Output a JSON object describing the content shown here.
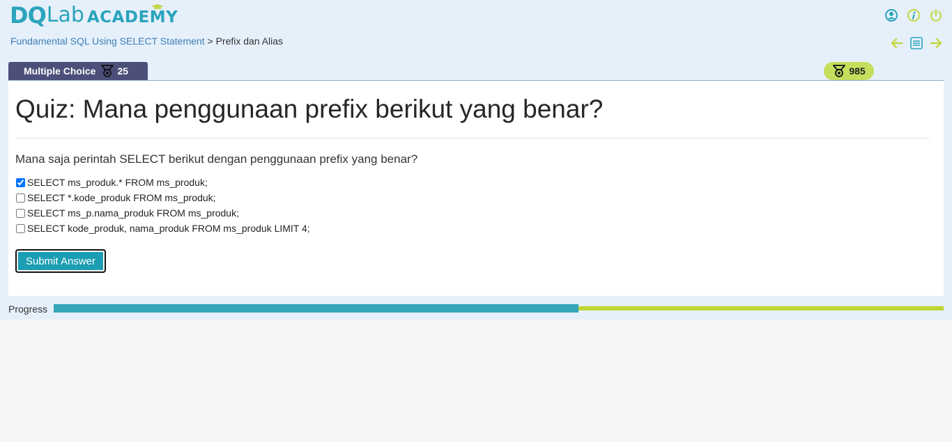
{
  "logo": {
    "dq": "DQ",
    "lab": "Lab",
    "academy": "ACADEMY"
  },
  "header": {
    "icons": [
      "user-icon",
      "info-icon",
      "power-icon"
    ],
    "accent": "#c5d742"
  },
  "breadcrumb": {
    "course": "Fundamental SQL Using SELECT Statement",
    "separator": " > ",
    "current": "Prefix dan Alias"
  },
  "navigation": {
    "icons": [
      "arrow-left-icon",
      "list-icon",
      "arrow-right-icon"
    ]
  },
  "tab": {
    "label": "Multiple Choice",
    "points": "25",
    "icon": "medal-icon"
  },
  "score": {
    "value": "985",
    "icon": "medal-icon"
  },
  "quiz": {
    "title": "Quiz: Mana penggunaan prefix berikut yang benar?",
    "question": "Mana saja perintah SELECT berikut dengan penggunaan prefix yang benar?",
    "options": [
      {
        "text": "SELECT ms_produk.* FROM ms_produk;",
        "checked": true
      },
      {
        "text": "SELECT *.kode_produk FROM ms_produk;",
        "checked": false
      },
      {
        "text": "SELECT ms_p.nama_produk FROM ms_produk;",
        "checked": false
      },
      {
        "text": "SELECT kode_produk, nama_produk FROM ms_produk LIMIT 4;",
        "checked": false
      }
    ],
    "submit_label": "Submit Answer"
  },
  "progress": {
    "label": "Progress",
    "percent": 59
  },
  "colors": {
    "teal": "#1b9db3",
    "lime": "#bdd630",
    "tab": "#4c4f7a"
  }
}
